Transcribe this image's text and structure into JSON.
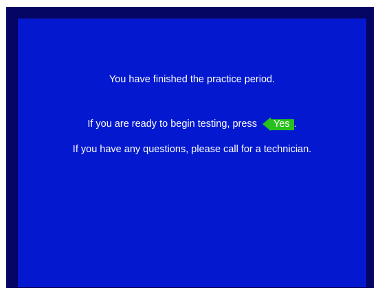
{
  "messages": {
    "finished": "You have finished the practice period.",
    "ready_prefix": "If you are ready to begin testing, press",
    "ready_suffix": ".",
    "questions": "If you have any questions, please call for a technician."
  },
  "buttons": {
    "yes_label": "Yes",
    "yes_icon": "left-arrow-icon"
  },
  "colors": {
    "outer_frame": "#050563",
    "screen_background": "#0419cf",
    "text": "#ffffff",
    "yes_button": "#27c01c"
  }
}
